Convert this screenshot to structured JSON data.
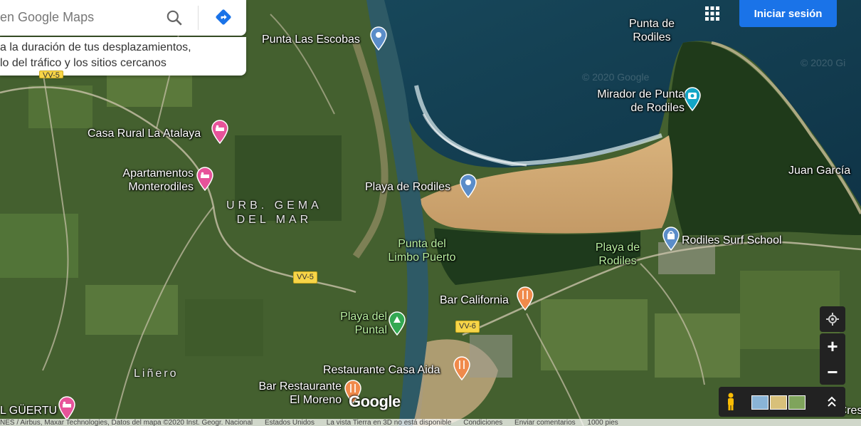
{
  "search": {
    "placeholder": "en Google Maps"
  },
  "tip": {
    "line1": "a la duración de tus desplazamientos,",
    "line2": "lo del tráfico y los sitios cercanos"
  },
  "header": {
    "signin_label": "Iniciar sesión"
  },
  "labels": {
    "punta_escobas": "Punta Las Escobas",
    "punta_rodiles": "Punta de Rodiles",
    "mirador": "Mirador de Punta de Rodiles",
    "casa_rural": "Casa Rural La Atalaya",
    "apartamentos": "Apartamentos Monterodiles",
    "urb_line1": "URB. GEMA",
    "urb_line2": "DEL MAR",
    "playa_rodiles": "Playa de Rodiles",
    "juan_garcia": "Juan García",
    "punta_limbo": "Punta del Limbo Puerto",
    "playa_rodiles_2": "Playa de Rodiles",
    "surf_school": "Rodiles Surf School",
    "bar_california": "Bar California",
    "playa_puntal": "Playa del Puntal",
    "restaurante_aida": "Restaurante Casa Aida",
    "bar_moreno": "Bar Restaurante El Moreno",
    "linero": "Liñero",
    "el_guertu": "L GÜERTU",
    "cres": "El Cres"
  },
  "roads": {
    "r1": "VV-5",
    "r2": "VV-5",
    "r3": "VV-6"
  },
  "watermark": "© 2020 Google",
  "brand": "Google",
  "footer": {
    "attribution": "NES / Airbus, Maxar Technologies, Datos del mapa ©2020 Inst. Geogr. Nacional",
    "country": "Estados Unidos",
    "earth3d": "La vista Tierra en 3D no está disponible",
    "terms": "Condiciones",
    "feedback": "Enviar comentarios",
    "scale": "1000 pies"
  },
  "colors": {
    "accent": "#1a73e8",
    "hotel_pin": "#e7539a",
    "food_pin": "#f08a4b",
    "poi_pin": "#5b8dc9",
    "park_pin": "#33a852",
    "camera_pin": "#13a6c6"
  }
}
